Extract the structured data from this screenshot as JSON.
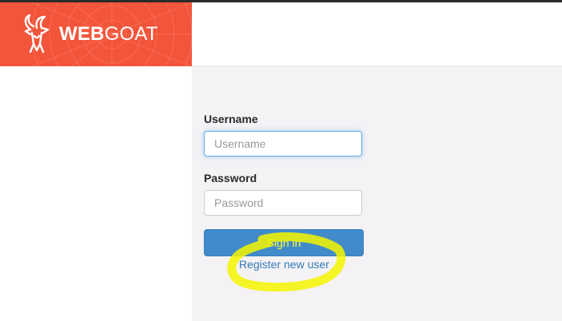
{
  "header": {
    "brand_bold": "WEB",
    "brand_light": "GOAT",
    "logo_icon": "goat-head-icon",
    "accent_color": "#f2553a"
  },
  "login": {
    "username_label": "Username",
    "username_placeholder": "Username",
    "username_value": "",
    "password_label": "Password",
    "password_placeholder": "Password",
    "password_value": "",
    "signin_label": "Sign in",
    "register_label": "Register new user"
  },
  "annotation": {
    "highlight_color": "#f5f500"
  }
}
